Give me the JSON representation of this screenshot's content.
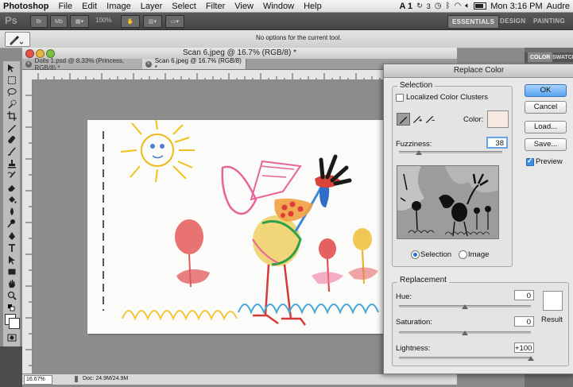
{
  "menubar": {
    "app": "Photoshop",
    "items": [
      "File",
      "Edit",
      "Image",
      "Layer",
      "Select",
      "Filter",
      "View",
      "Window",
      "Help"
    ],
    "status_a1": "A 1",
    "status_num": "3",
    "clock": "Mon 3:16 PM",
    "user": "Audre"
  },
  "appbar": {
    "logo": "Ps",
    "zoom_label": "100%",
    "workspaces": [
      "ESSENTIALS",
      "DESIGN",
      "PAINTING"
    ]
  },
  "options": {
    "message": "No options for the current tool."
  },
  "window": {
    "title": "Scan 6.jpeg @ 16.7% (RGB/8) *"
  },
  "tabs": [
    {
      "label": "Dolls 1.psd @ 8.33% (Princess, RGB/8) *"
    },
    {
      "label": "Scan 6.jpeg @ 16.7% (RGB/8) *"
    }
  ],
  "panel_tabs": [
    "COLOR",
    "SWATCH"
  ],
  "statusbar": {
    "zoom": "16.67%",
    "doc": "Doc: 24.9M/24.9M"
  },
  "dialog": {
    "title": "Replace Color",
    "selection_group": "Selection",
    "localized_label": "Localized Color Clusters",
    "localized_checked": false,
    "color_label": "Color:",
    "selection_color": "#f6e9e2",
    "fuzziness_label": "Fuzziness:",
    "fuzziness_value": "38",
    "fuzziness_level": 0.19,
    "radio_selection": "Selection",
    "radio_image": "Image",
    "replacement_group": "Replacement",
    "hue_label": "Hue:",
    "hue_value": "0",
    "hue_level": 0.5,
    "saturation_label": "Saturation:",
    "saturation_value": "0",
    "saturation_level": 0.5,
    "lightness_label": "Lightness:",
    "lightness_value": "+100",
    "lightness_level": 1.0,
    "result_label": "Result",
    "result_color": "#ffffff",
    "buttons": {
      "ok": "OK",
      "cancel": "Cancel",
      "load": "Load...",
      "save": "Save..."
    },
    "preview_label": "Preview",
    "preview_checked": true
  }
}
